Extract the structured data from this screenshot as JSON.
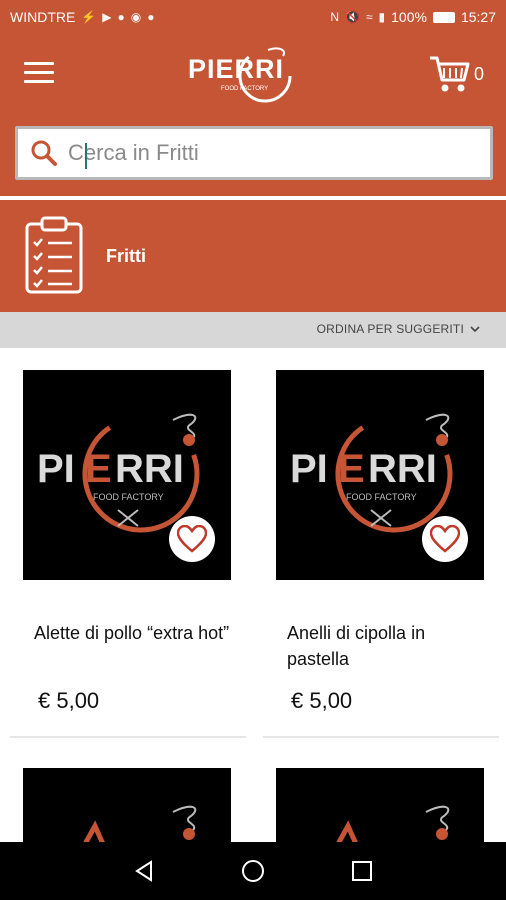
{
  "status_bar": {
    "carrier": "WINDTRE",
    "battery": "100%",
    "time": "15:27",
    "icons": [
      "usb-icon",
      "youtube-icon",
      "facebook-icon",
      "instagram-icon",
      "chat-icon",
      "nfc-icon",
      "mute-icon",
      "wifi-icon",
      "signal-icon",
      "battery-icon"
    ]
  },
  "app_bar": {
    "logo_text": "PIERRI",
    "logo_subtext": "FOOD FACTORY",
    "cart_count": "0",
    "icons": [
      "menu-icon",
      "cart-icon"
    ]
  },
  "search": {
    "placeholder": "Cerca in Fritti",
    "value": ""
  },
  "category": {
    "title": "Fritti",
    "icon": "clipboard-list-icon"
  },
  "sort": {
    "label": "ORDINA PER SUGGERITI"
  },
  "products": [
    {
      "name": "Alette di pollo “extra hot”",
      "price": "€ 5,00"
    },
    {
      "name": "Anelli di cipolla in pastella",
      "price": "€ 5,00"
    }
  ],
  "colors": {
    "brand": "#c65535",
    "sort_bar": "#d7d7d7",
    "logo_accent": "#c65535"
  }
}
